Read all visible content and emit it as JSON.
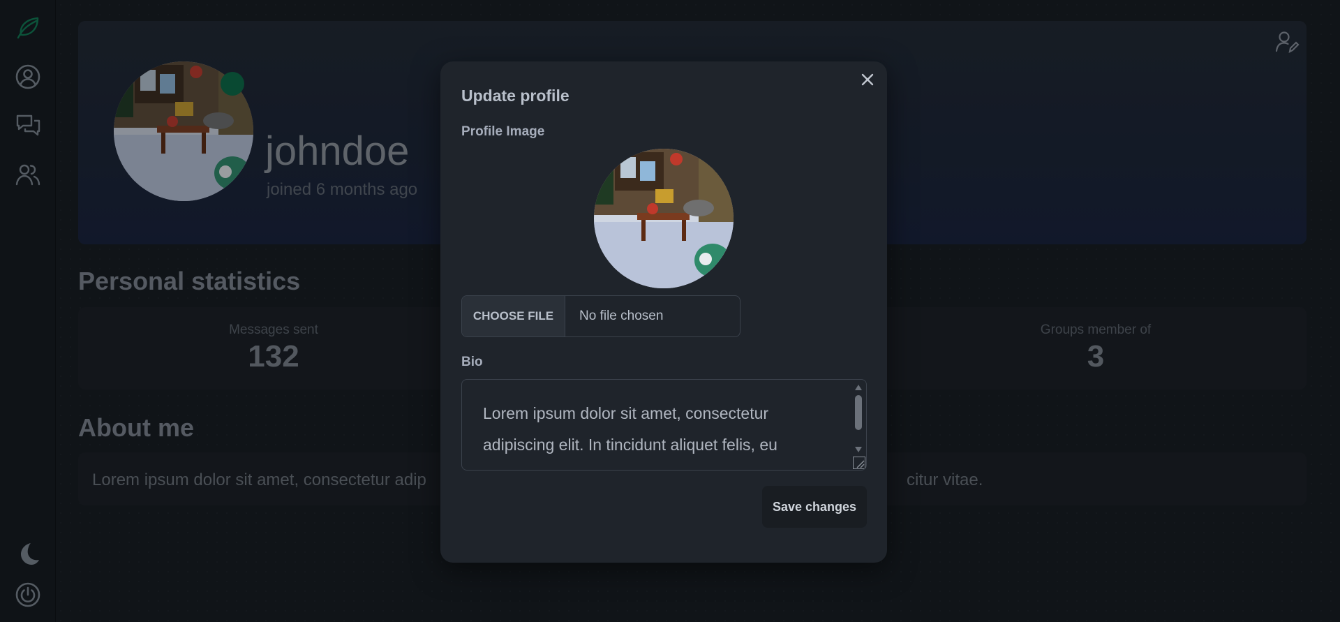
{
  "profile": {
    "username": "johndoe",
    "joined": "joined 6 months ago"
  },
  "stats": {
    "title": "Personal statistics",
    "items": [
      {
        "label": "Messages sent",
        "value": "132"
      },
      {
        "label": "Groups member of",
        "value": "3"
      }
    ]
  },
  "about": {
    "title": "About me",
    "text_left": "Lorem ipsum dolor sit amet, consectetur adip",
    "text_right": "citur vitae."
  },
  "modal": {
    "title": "Update profile",
    "profile_image_label": "Profile Image",
    "file_button": "CHOOSE FILE",
    "file_status": "No file chosen",
    "bio_label": "Bio",
    "bio_value": "Lorem ipsum dolor sit amet, consectetur adipiscing elit. In tincidunt aliquet felis, eu sollicitudin ante efficitur vitae.",
    "save_label": "Save changes"
  },
  "sidebar": {
    "icons": [
      "leaf-icon",
      "profile-icon",
      "chats-icon",
      "groups-icon",
      "theme-moon-icon",
      "power-icon"
    ]
  },
  "colors": {
    "accent": "#0a6b46",
    "background": "#15191e",
    "modal": "#1f242b"
  }
}
